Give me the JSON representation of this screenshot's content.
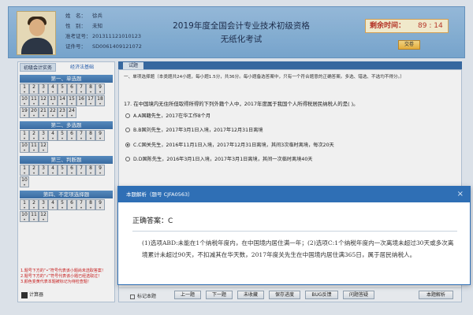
{
  "header": {
    "candidate": [
      {
        "label": "姓　名：",
        "value": "徐兵"
      },
      {
        "label": "性　别：",
        "value": "未知"
      },
      {
        "label": "准考证号：",
        "value": "201311121010123"
      },
      {
        "label": "证件号：",
        "value": "SD0061409121072"
      }
    ],
    "title_line1": "2019年度全国会计专业技术初级资格",
    "title_line2": "无纸化考试",
    "timer_label": "剩余时间：",
    "timer_value": "89 : 14",
    "submit_label": "交卷"
  },
  "left_panel": {
    "tabs": [
      "初级会计实务",
      "经济法基础"
    ],
    "sections": [
      {
        "title": "第一、单选题",
        "count": 24
      },
      {
        "title": "第二、多选题",
        "count": 12
      },
      {
        "title": "第三、判断题",
        "count": 10
      },
      {
        "title": "第四、不定项选择题",
        "count": 12
      }
    ],
    "cell_mark": "•",
    "notes": [
      "1.题号下方的“•”符号代表该小题尚未选取答案！",
      "2.题号下方的“√”符号代表该小题已经选取过！",
      "3.颜色变黄代表本题被标记为待检查题！"
    ],
    "calculator_label": "计算器"
  },
  "question": {
    "tab_label": "试题",
    "instruction": "一、单项选择题（本类题共24小题，每小题1.5分，共36分。每小题备选答案中，只有一个符合题意的正确答案。多选、错选、不选均不得分。）",
    "text": "17. 在中国境内无住所但取得所得的下列外籍个人中，2017年度属于我国个人所得税居民纳税人的是(  )。",
    "options": [
      "A.A国籍先生，2017在华工作8个月",
      "B.B国刘先生，2017年3月1日入境，2017年12月31日离境",
      "C.C国关先生，2016年11月1日入境，2017年12月31日离境，其间3次临时离境，每次20天",
      "D.D国陈先生，2016年3月1日入境，2017年3月1日离境，其间一次临时离境40天"
    ],
    "selected_index": 2
  },
  "bottom_bar": {
    "mark_label": "标记本题",
    "buttons": [
      "上一题",
      "下一题",
      "未收藏",
      "保存进度",
      "BUG反馈",
      "问题答疑",
      "本题解析"
    ]
  },
  "dialog": {
    "title": "本题解析（题号 CJFA0563）",
    "close_label": "×",
    "answer": "正确答案：C",
    "explanation": "(1)选项ABD:未能在1个纳税年度内，在中国境内居住满一年；(2)选项C:1个纳税年度内一次离境未超过30天或多次离境累计未超过90天，不扣减其在华天数，2017年度关先生在中国境内居住满365日，属于居民纳税人。"
  },
  "colors": {
    "header_bg": "#8fb8e0",
    "section_bg": "#4a83bd",
    "dialog_head": "#2f6fb5",
    "note_text": "#d42020",
    "timer_text": "#c0392b"
  }
}
